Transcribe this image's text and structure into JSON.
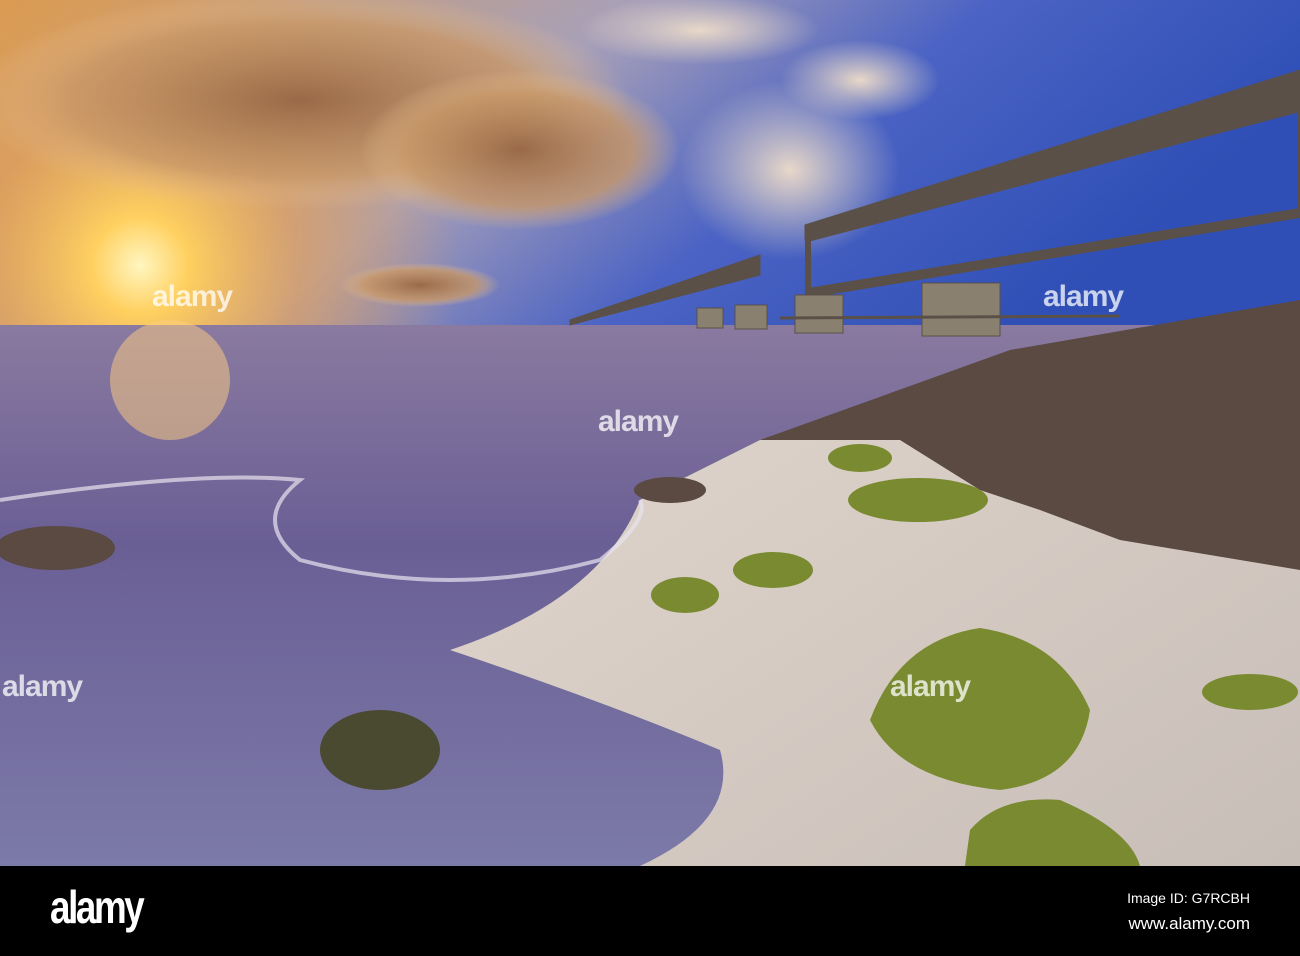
{
  "photo": {
    "subject": "sunset-beach-old-railway-bridge"
  },
  "watermark": {
    "text": "alamy"
  },
  "footer": {
    "logo": "alamy",
    "image_id": "Image ID: G7RCBH",
    "url": "www.alamy.com"
  },
  "colors": {
    "sky_top": "#3a57b8",
    "sun": "#ffe07a",
    "sea": "#6a6aa0",
    "sand": "#d8cfc6",
    "moss": "#8fa030"
  }
}
